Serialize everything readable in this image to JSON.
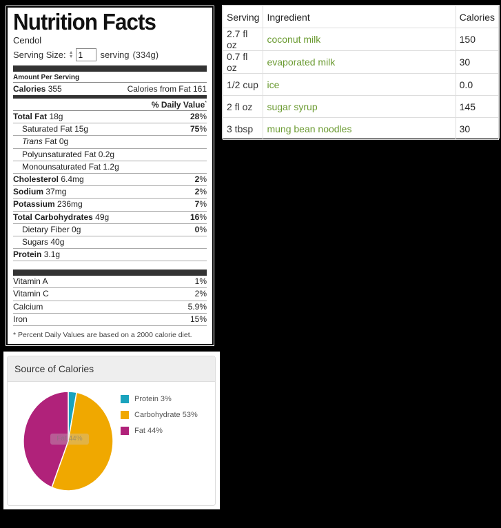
{
  "label": {
    "title": "Nutrition Facts",
    "recipe_name": "Cendol",
    "serving_size_label": "Serving Size:",
    "serving_value": "1",
    "serving_unit": "serving",
    "serving_grams": "(334g)",
    "amount_per_serving": "Amount Per Serving",
    "calories_label": "Calories",
    "calories_value": "355",
    "calories_from_fat_label": "Calories from Fat",
    "calories_from_fat_value": "161",
    "daily_value_head": "% Daily Value",
    "daily_value_mark": "*",
    "nutrients": [
      {
        "name": "Total Fat",
        "amount": "18g",
        "pct": "28",
        "bold": true
      },
      {
        "name": "Saturated Fat",
        "amount": "15g",
        "pct": "75",
        "indent": true
      },
      {
        "name": "Trans",
        "name2": "Fat",
        "amount": "0g",
        "indent": true
      },
      {
        "name": "Polyunsaturated Fat",
        "amount": "0.2g",
        "indent": true
      },
      {
        "name": "Monounsaturated Fat",
        "amount": "1.2g",
        "indent": true
      },
      {
        "name": "Cholesterol",
        "amount": "6.4mg",
        "pct": "2",
        "bold": true
      },
      {
        "name": "Sodium",
        "amount": "37mg",
        "pct": "2",
        "bold": true
      },
      {
        "name": "Potassium",
        "amount": "236mg",
        "pct": "7",
        "bold": true
      },
      {
        "name": "Total Carbohydrates",
        "amount": "49g",
        "pct": "16",
        "bold": true
      },
      {
        "name": "Dietary Fiber",
        "amount": "0g",
        "pct": "0",
        "indent": true
      },
      {
        "name": "Sugars",
        "amount": "40g",
        "indent": true
      },
      {
        "name": "Protein",
        "amount": "3.1g",
        "bold": true
      }
    ],
    "percent_symbol": "%",
    "vitamins": [
      {
        "name": "Vitamin A",
        "pct": "1%"
      },
      {
        "name": "Vitamin C",
        "pct": "2%"
      },
      {
        "name": "Calcium",
        "pct": "5.9%"
      },
      {
        "name": "Iron",
        "pct": "15%"
      }
    ],
    "footnote": "* Percent Daily Values are based on a 2000 calorie diet."
  },
  "ingredients": {
    "headers": [
      "Serving",
      "Ingredient",
      "Calories"
    ],
    "rows": [
      {
        "serving": "2.7 fl oz",
        "ingredient": "coconut milk",
        "calories": "150"
      },
      {
        "serving": "0.7 fl oz",
        "ingredient": "evaporated milk",
        "calories": "30"
      },
      {
        "serving": "1/2 cup",
        "ingredient": "ice",
        "calories": "0.0"
      },
      {
        "serving": "2 fl oz",
        "ingredient": "sugar syrup",
        "calories": "145"
      },
      {
        "serving": "3 tbsp",
        "ingredient": "mung bean noodles",
        "calories": "30"
      }
    ],
    "link_color": "#6a9a30"
  },
  "source_of_calories": {
    "title": "Source of Calories",
    "hover_label": "Fat 44%",
    "chart_data": {
      "type": "pie",
      "categories": [
        "Protein",
        "Carbohydrate",
        "Fat"
      ],
      "values": [
        3,
        53,
        44
      ],
      "legend_labels": [
        "Protein 3%",
        "Carbohydrate 53%",
        "Fat 44%"
      ],
      "colors": [
        "#1aa3bd",
        "#f0a800",
        "#b0227a"
      ],
      "legend": "right"
    }
  }
}
